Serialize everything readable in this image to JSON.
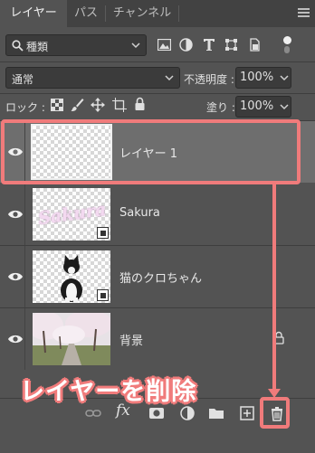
{
  "tabs": [
    {
      "label": "レイヤー"
    },
    {
      "label": "パス"
    },
    {
      "label": "チャンネル"
    }
  ],
  "filter": {
    "search_label": "種類"
  },
  "blend": {
    "mode": "通常",
    "opacity_label": "不透明度 :",
    "opacity_value": "100%"
  },
  "lock": {
    "label": "ロック :",
    "fill_label": "塗り :",
    "fill_value": "100%"
  },
  "layers": [
    {
      "name": "レイヤー 1"
    },
    {
      "name": "Sakura",
      "thumb_text": "Sakura"
    },
    {
      "name": "猫のクロちゃん"
    },
    {
      "name": "背景"
    }
  ],
  "bottombar": {
    "fx_label": "fx"
  },
  "annotation": {
    "text": "レイヤーを削除",
    "color": "#f07b7b"
  }
}
